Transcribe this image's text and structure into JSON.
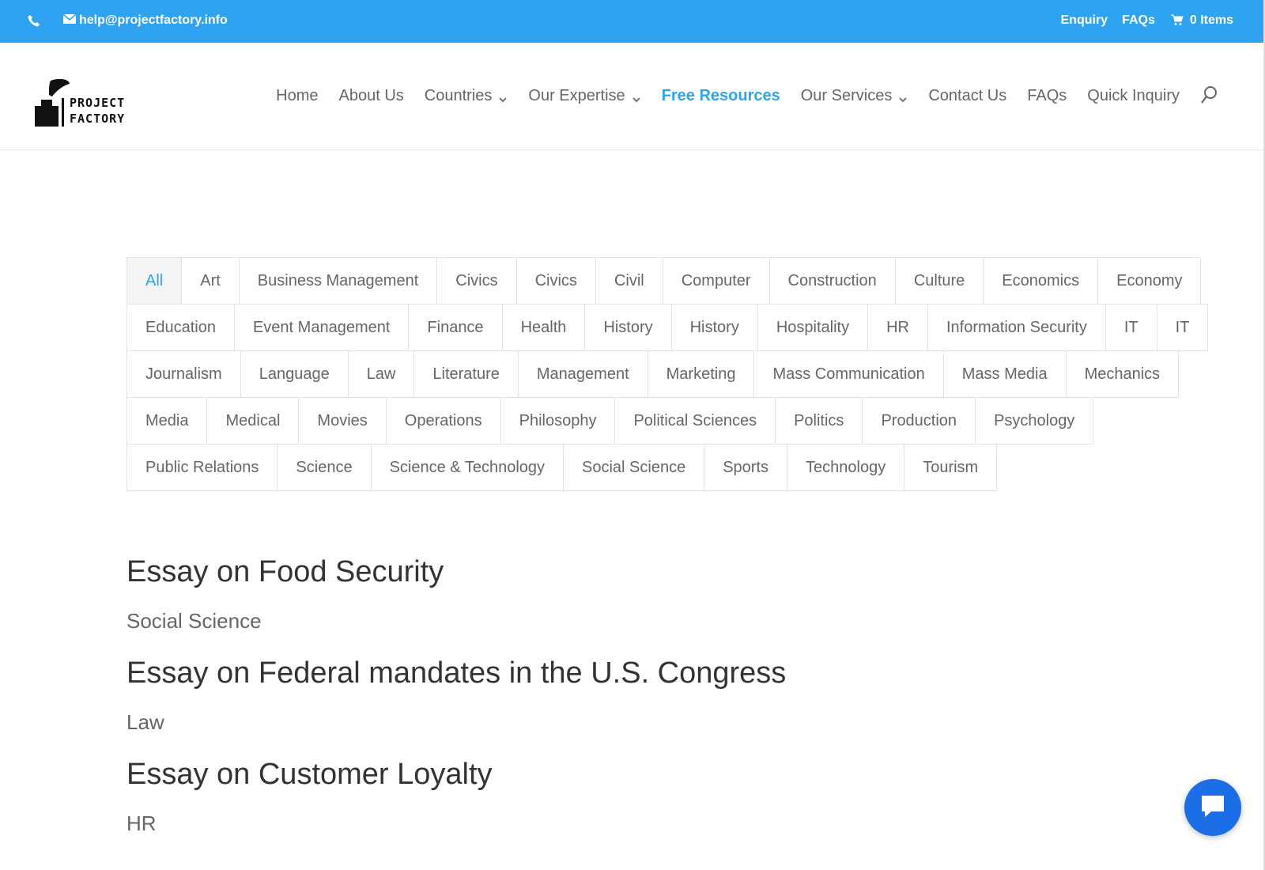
{
  "topbar": {
    "phone_icon": "phone-icon",
    "email_icon": "envelope-icon",
    "email": "help@projectfactory.info",
    "links": [
      "Enquiry",
      "FAQs"
    ],
    "cart_icon": "cart-icon",
    "cart_label": "0 Items"
  },
  "logo": {
    "line1": "PROJECT",
    "line2": "FACTORY"
  },
  "nav": {
    "items": [
      {
        "label": "Home",
        "dropdown": false
      },
      {
        "label": "About Us",
        "dropdown": false
      },
      {
        "label": "Countries",
        "dropdown": true
      },
      {
        "label": "Our Expertise",
        "dropdown": true
      },
      {
        "label": "Free Resources",
        "dropdown": false,
        "active": true
      },
      {
        "label": "Our Services",
        "dropdown": true
      },
      {
        "label": "Contact Us",
        "dropdown": false
      },
      {
        "label": "FAQs",
        "dropdown": false
      },
      {
        "label": "Quick Inquiry",
        "dropdown": false
      }
    ],
    "search_icon": "search-icon"
  },
  "filters": {
    "rows": [
      [
        "All",
        "Art",
        "Business Management",
        "Civics",
        "Civics",
        "Civil",
        "Computer",
        "Construction",
        "Culture",
        "Economics",
        "Economy"
      ],
      [
        "Education",
        "Event Management",
        "Finance",
        "Health",
        "History",
        "History",
        "Hospitality",
        "HR",
        "Information Security",
        "IT",
        "IT"
      ],
      [
        "Journalism",
        "Language",
        "Law",
        "Literature",
        "Management",
        "Marketing",
        "Mass Communication",
        "Mass Media",
        "Mechanics"
      ],
      [
        "Media",
        "Medical",
        "Movies",
        "Operations",
        "Philosophy",
        "Political Sciences",
        "Politics",
        "Production",
        "Psychology"
      ],
      [
        "Public Relations",
        "Science",
        "Science & Technology",
        "Social Science",
        "Sports",
        "Technology",
        "Tourism"
      ]
    ],
    "active": "All"
  },
  "articles": [
    {
      "title": "Essay on Food Security",
      "category": "Social Science"
    },
    {
      "title": "Essay on Federal mandates in the U.S. Congress",
      "category": "Law"
    },
    {
      "title": "Essay on Customer Loyalty",
      "category": "HR"
    }
  ],
  "chat_icon": "chat-bubble-icon",
  "colors": {
    "accent": "#2ea3f2",
    "topbar": "#2ea3f2",
    "chat": "#1c6ee8"
  }
}
